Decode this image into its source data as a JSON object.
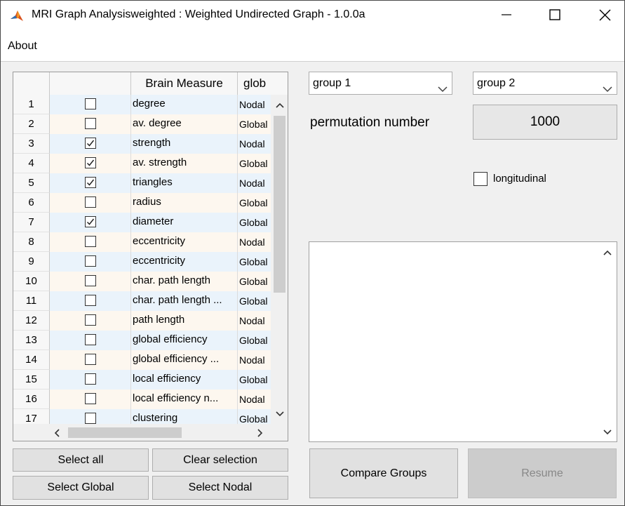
{
  "window": {
    "title": "MRI Graph Analysisweighted : Weighted Undirected Graph  - 1.0.0a",
    "app_icon": "matlab-icon",
    "controls": [
      "minimize-icon",
      "maximize-icon",
      "close-icon"
    ]
  },
  "menu": {
    "items": [
      {
        "label": "About"
      }
    ]
  },
  "table": {
    "headers": {
      "num": "",
      "check": "",
      "measure": "Brain Measure",
      "type": "glob"
    },
    "rows": [
      {
        "num": "1",
        "checked": false,
        "measure": "degree",
        "type": "Nodal"
      },
      {
        "num": "2",
        "checked": false,
        "measure": "av. degree",
        "type": "Global"
      },
      {
        "num": "3",
        "checked": true,
        "measure": "strength",
        "type": "Nodal"
      },
      {
        "num": "4",
        "checked": true,
        "measure": "av. strength",
        "type": "Global"
      },
      {
        "num": "5",
        "checked": true,
        "measure": "triangles",
        "type": "Nodal"
      },
      {
        "num": "6",
        "checked": false,
        "measure": "radius",
        "type": "Global"
      },
      {
        "num": "7",
        "checked": true,
        "measure": "diameter",
        "type": "Global"
      },
      {
        "num": "8",
        "checked": false,
        "measure": "eccentricity",
        "type": "Nodal"
      },
      {
        "num": "9",
        "checked": false,
        "measure": "eccentricity",
        "type": "Global"
      },
      {
        "num": "10",
        "checked": false,
        "measure": "char. path length",
        "type": "Global"
      },
      {
        "num": "11",
        "checked": false,
        "measure": "char. path length ...",
        "type": "Global"
      },
      {
        "num": "12",
        "checked": false,
        "measure": "path length",
        "type": "Nodal"
      },
      {
        "num": "13",
        "checked": false,
        "measure": "global efficiency",
        "type": "Global"
      },
      {
        "num": "14",
        "checked": false,
        "measure": "global efficiency ...",
        "type": "Nodal"
      },
      {
        "num": "15",
        "checked": false,
        "measure": "local efficiency",
        "type": "Global"
      },
      {
        "num": "16",
        "checked": false,
        "measure": "local efficiency n...",
        "type": "Nodal"
      },
      {
        "num": "17",
        "checked": false,
        "measure": "clustering",
        "type": "Global"
      }
    ]
  },
  "buttons": {
    "select_all": "Select all",
    "clear_selection": "Clear selection",
    "select_global": "Select Global",
    "select_nodal": "Select Nodal",
    "compare_groups": "Compare Groups",
    "resume": "Resume"
  },
  "groups": {
    "group1": "group 1",
    "group2": "group 2"
  },
  "permutation": {
    "label": "permutation number",
    "value": "1000"
  },
  "longitudinal": {
    "label": "longitudinal",
    "checked": false
  },
  "log": {
    "text": ""
  }
}
